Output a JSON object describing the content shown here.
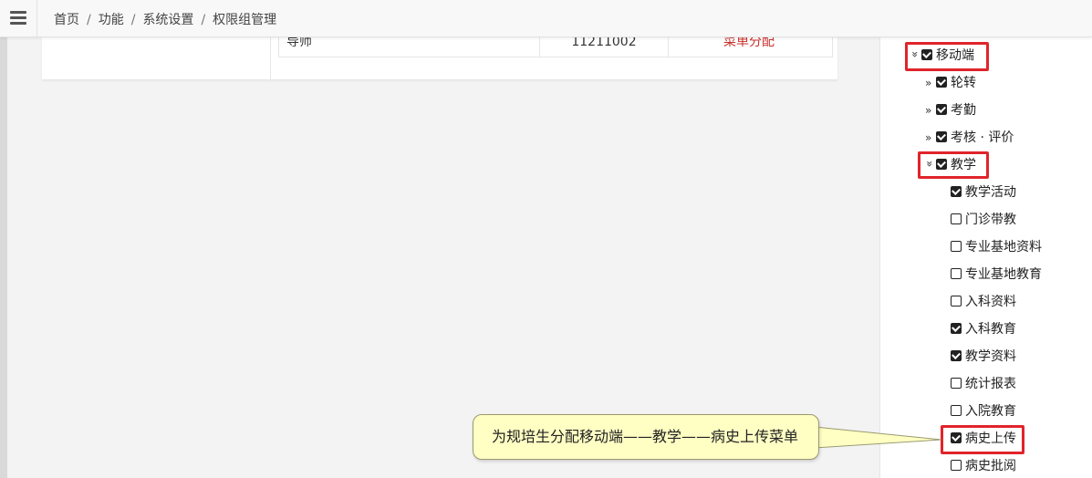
{
  "breadcrumb": [
    "首页",
    "功能",
    "系统设置",
    "权限组管理"
  ],
  "table_row": {
    "name": "导师",
    "code": "11211002",
    "action": "菜单分配"
  },
  "tree": [
    {
      "label": "移动端",
      "toggle": "expanded",
      "checked": true,
      "highlighted": true
    },
    {
      "label": "轮转",
      "toggle": "collapsed",
      "checked": true,
      "highlighted": false
    },
    {
      "label": "考勤",
      "toggle": "collapsed",
      "checked": true,
      "highlighted": false
    },
    {
      "label": "考核 · 评价",
      "toggle": "collapsed",
      "checked": true,
      "highlighted": false
    },
    {
      "label": "教学",
      "toggle": "expanded",
      "checked": true,
      "highlighted": true
    },
    {
      "label": "教学活动",
      "checked": true,
      "highlighted": false
    },
    {
      "label": "门诊带教",
      "checked": false,
      "highlighted": false
    },
    {
      "label": "专业基地资料",
      "checked": false,
      "highlighted": false
    },
    {
      "label": "专业基地教育",
      "checked": false,
      "highlighted": false
    },
    {
      "label": "入科资料",
      "checked": false,
      "highlighted": false
    },
    {
      "label": "入科教育",
      "checked": true,
      "highlighted": false
    },
    {
      "label": "教学资料",
      "checked": true,
      "highlighted": false
    },
    {
      "label": "统计报表",
      "checked": false,
      "highlighted": false
    },
    {
      "label": "入院教育",
      "checked": false,
      "highlighted": false
    },
    {
      "label": "病史上传",
      "checked": true,
      "highlighted": true
    },
    {
      "label": "病史批阅",
      "checked": false,
      "highlighted": false
    }
  ],
  "callout_text": "为规培生分配移动端——教学——病史上传菜单",
  "colors": {
    "highlight": "#e0242a",
    "callout_bg": "#ffffc4",
    "action_link": "#c9302c"
  }
}
